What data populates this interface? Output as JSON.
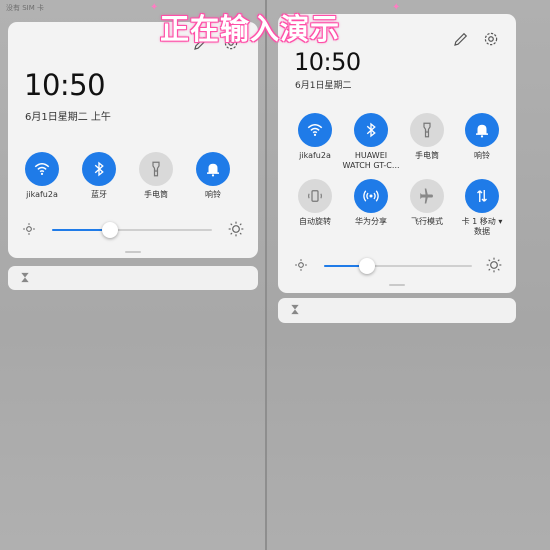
{
  "overlay": {
    "title": "正在输入演示"
  },
  "left": {
    "status_text": "没有 SIM 卡",
    "clock": "10:50",
    "date": "6月1日星期二 上午",
    "tiles": [
      {
        "label": "jikafu2a",
        "icon": "wifi-icon",
        "active": true
      },
      {
        "label": "蓝牙",
        "icon": "bluetooth-icon",
        "active": true
      },
      {
        "label": "手电筒",
        "icon": "flashlight-icon",
        "active": false
      },
      {
        "label": "响铃",
        "icon": "bell-icon",
        "active": true
      }
    ],
    "brightness": 0.36
  },
  "right": {
    "clock": "10:50",
    "date": "6月1日星期二",
    "tiles_row1": [
      {
        "label": "jikafu2a",
        "icon": "wifi-icon",
        "active": true
      },
      {
        "label": "HUAWEI",
        "label2": "WATCH GT-C...",
        "icon": "bluetooth-icon",
        "active": true
      },
      {
        "label": "手电筒",
        "icon": "flashlight-icon",
        "active": false
      },
      {
        "label": "响铃",
        "icon": "bell-icon",
        "active": true
      }
    ],
    "tiles_row2": [
      {
        "label": "自动旋转",
        "icon": "auto-rotate-icon",
        "active": false
      },
      {
        "label": "华为分享",
        "icon": "huawei-share-icon",
        "active": true
      },
      {
        "label": "飞行模式",
        "icon": "airplane-icon",
        "active": false
      },
      {
        "label": "卡 1 移动 ▾",
        "label2": "数据",
        "icon": "mobile-data-icon",
        "active": true
      }
    ],
    "brightness": 0.29
  },
  "colors": {
    "accent": "#1f7be8",
    "inactive": "#d9d9d9",
    "card": "#f3f3f3",
    "overlay_outline": "#ff4fa8"
  }
}
